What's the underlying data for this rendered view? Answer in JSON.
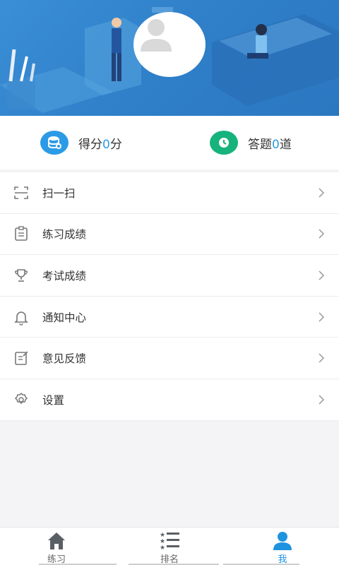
{
  "stats": {
    "score_prefix": "得分",
    "score_value": "0",
    "score_suffix": "分",
    "answered_prefix": "答题",
    "answered_value": "0",
    "answered_suffix": "道",
    "score_icon": "database-icon",
    "answered_icon": "clock-icon"
  },
  "menu": {
    "items": [
      {
        "label": "扫一扫",
        "icon": "scan-icon"
      },
      {
        "label": "练习成绩",
        "icon": "clipboard-icon"
      },
      {
        "label": "考试成绩",
        "icon": "trophy-icon"
      },
      {
        "label": "通知中心",
        "icon": "bell-icon"
      },
      {
        "label": "意见反馈",
        "icon": "feedback-icon"
      },
      {
        "label": "设置",
        "icon": "gear-icon"
      }
    ]
  },
  "tabbar": {
    "tabs": [
      {
        "label": "练习",
        "icon": "home-icon"
      },
      {
        "label": "排名",
        "icon": "list-icon"
      },
      {
        "label": "我",
        "icon": "user-icon"
      }
    ],
    "active_index": 2
  },
  "colors": {
    "accent": "#1e93e0",
    "score_icon_bg": "#2c9be6",
    "answered_icon_bg": "#17b37c",
    "hero_bg": "#3a8fd6"
  }
}
